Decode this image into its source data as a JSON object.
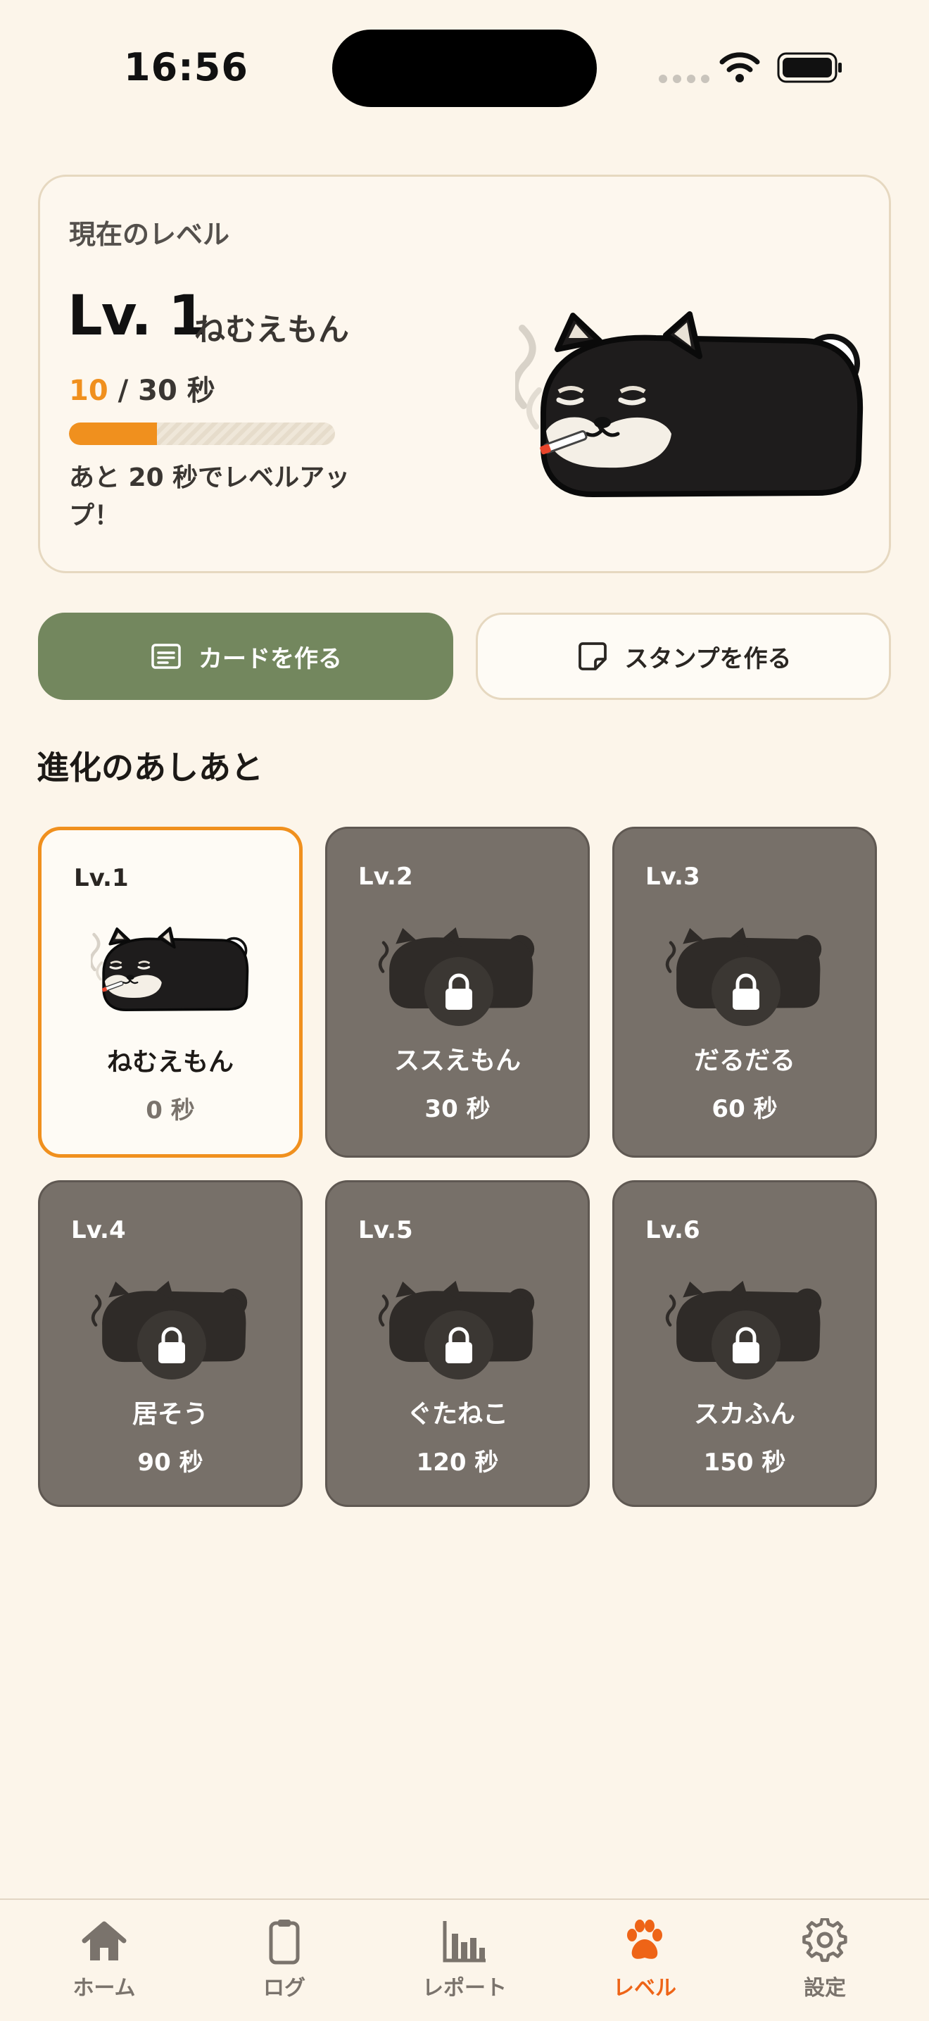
{
  "status": {
    "time": "16:56"
  },
  "current_level": {
    "label": "現在のレベル",
    "level": "Lv. 1",
    "name": "ねむえもん",
    "progress_current": "10",
    "progress_suffix": " / 30 秒",
    "progress_fraction": 0.33,
    "remaining": "あと 20 秒でレベルアップ！"
  },
  "actions": {
    "make_card": "カードを作る",
    "make_stamp": "スタンプを作る"
  },
  "evolution": {
    "title": "進化のあしあと",
    "items": [
      {
        "lv": "Lv.1",
        "name": "ねむえもん",
        "seconds": "0 秒",
        "locked": false
      },
      {
        "lv": "Lv.2",
        "name": "ススえもん",
        "seconds": "30 秒",
        "locked": true
      },
      {
        "lv": "Lv.3",
        "name": "だるだる",
        "seconds": "60 秒",
        "locked": true
      },
      {
        "lv": "Lv.4",
        "name": "居そう",
        "seconds": "90 秒",
        "locked": true
      },
      {
        "lv": "Lv.5",
        "name": "ぐたねこ",
        "seconds": "120 秒",
        "locked": true
      },
      {
        "lv": "Lv.6",
        "name": "スカふん",
        "seconds": "150 秒",
        "locked": true
      }
    ]
  },
  "tabs": [
    {
      "label": "ホーム",
      "icon": "home-icon"
    },
    {
      "label": "ログ",
      "icon": "clipboard-icon"
    },
    {
      "label": "レポート",
      "icon": "bar-chart-icon"
    },
    {
      "label": "レベル",
      "icon": "paw-icon",
      "active": true
    },
    {
      "label": "設定",
      "icon": "gear-icon"
    }
  ],
  "colors": {
    "accent": "#F0901E",
    "tab_active": "#EE6417",
    "green": "#73875E",
    "background": "#FCF5EA"
  }
}
